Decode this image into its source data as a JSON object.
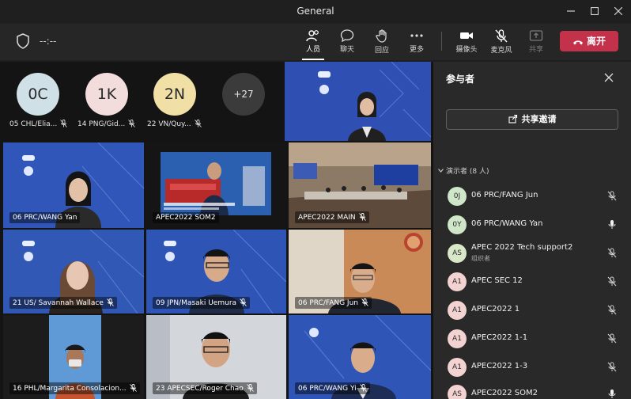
{
  "window": {
    "title": "General"
  },
  "toolbar": {
    "timer": "--:--",
    "people": "人员",
    "chat": "聊天",
    "raise_hand": "回应",
    "more": "更多",
    "camera": "摄像头",
    "mic": "麦克风",
    "share": "共享",
    "leave": "离开"
  },
  "colors": {
    "leave": "#c4314b",
    "tile_bg": "#3a58b8",
    "selected": "#8b8cf0"
  },
  "avatars": [
    {
      "initials": "0C",
      "name": "05 CHL/Elia...",
      "color": "#cfe0e6"
    },
    {
      "initials": "1K",
      "name": "14 PNG/Gid...",
      "color": "#f3dcdc"
    },
    {
      "initials": "2N",
      "name": "22 VN/Quy...",
      "color": "#f1e0a6"
    }
  ],
  "more_count": "+27",
  "tiles": [
    {
      "label": "06 PRC/WANG Yan"
    },
    {
      "label": "APEC2022 SOM2"
    },
    {
      "label": "APEC2022 MAIN"
    },
    {
      "label": "21 US/ Savannah Wallace"
    },
    {
      "label": "09 JPN/Masaki Uemura"
    },
    {
      "label": "06 PRC/FANG Jun"
    },
    {
      "label": "16 PHL/Margarita Consolacion..."
    },
    {
      "label": "23 APECSEC/Roger Chao"
    },
    {
      "label": "06 PRC/WANG Yi"
    }
  ],
  "panel": {
    "title": "参与者",
    "share_invite": "共享邀请",
    "group": "演示者 (8 人)",
    "participants": [
      {
        "initials": "0J",
        "name": "06 PRC/FANG Jun",
        "sub": "",
        "mic": "off",
        "color": "#cfe6c9"
      },
      {
        "initials": "0Y",
        "name": "06 PRC/WANG Yan",
        "sub": "",
        "mic": "on",
        "color": "#cfe6c9"
      },
      {
        "initials": "AS",
        "name": "APEC 2022 Tech support2",
        "sub": "组织者",
        "mic": "off",
        "color": "#d8e8c8"
      },
      {
        "initials": "A1",
        "name": "APEC SEC 12",
        "sub": "",
        "mic": "off",
        "color": "#f3d2d2"
      },
      {
        "initials": "A1",
        "name": "APEC2022 1",
        "sub": "",
        "mic": "off",
        "color": "#f3d2d2"
      },
      {
        "initials": "A1",
        "name": "APEC2022 1-1",
        "sub": "",
        "mic": "off",
        "color": "#f3d2d2"
      },
      {
        "initials": "A1",
        "name": "APEC2022 1-3",
        "sub": "",
        "mic": "off",
        "color": "#f3d2d2"
      },
      {
        "initials": "AS",
        "name": "APEC2022 SOM2",
        "sub": "",
        "mic": "on",
        "color": "#f3d2d2"
      }
    ]
  }
}
